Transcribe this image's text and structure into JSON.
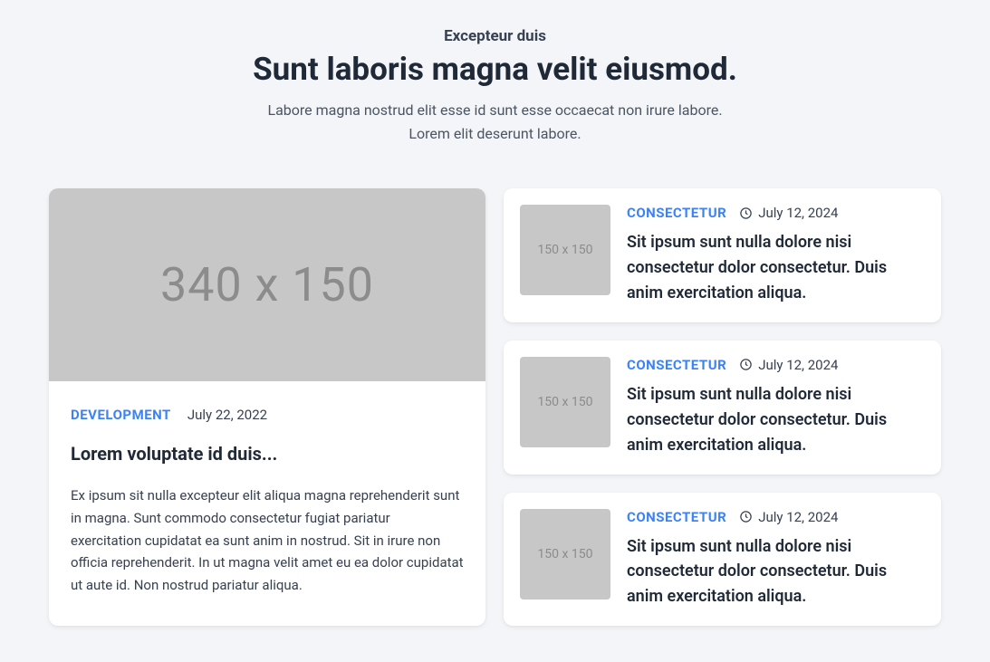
{
  "header": {
    "eyebrow": "Excepteur duis",
    "heading": "Sunt laboris magna velit eiusmod.",
    "subtext": "Labore magna nostrud elit esse id sunt esse occaecat non irure labore. Lorem elit deserunt labore."
  },
  "featured": {
    "image_label": "340 x 150",
    "category": "DEVELOPMENT",
    "date": "July 22, 2022",
    "title": "Lorem voluptate id duis...",
    "excerpt": "Ex ipsum sit nulla excepteur elit aliqua magna reprehenderit sunt in magna. Sunt commodo consectetur fugiat pariatur exercitation cupidatat ea sunt anim in nostrud. Sit in irure non officia reprehenderit. In ut magna velit amet eu ea dolor cupidatat ut aute id. Non nostrud pariatur aliqua."
  },
  "side_items": [
    {
      "thumb_label": "150 x 150",
      "category": "CONSECTETUR",
      "date": "July 12, 2024",
      "title": "Sit ipsum sunt nulla dolore nisi consectetur dolor consectetur. Duis anim exercitation aliqua."
    },
    {
      "thumb_label": "150 x 150",
      "category": "CONSECTETUR",
      "date": "July 12, 2024",
      "title": "Sit ipsum sunt nulla dolore nisi consectetur dolor consectetur. Duis anim exercitation aliqua."
    },
    {
      "thumb_label": "150 x 150",
      "category": "CONSECTETUR",
      "date": "July 12, 2024",
      "title": "Sit ipsum sunt nulla dolore nisi consectetur dolor consectetur. Duis anim exercitation aliqua."
    }
  ]
}
